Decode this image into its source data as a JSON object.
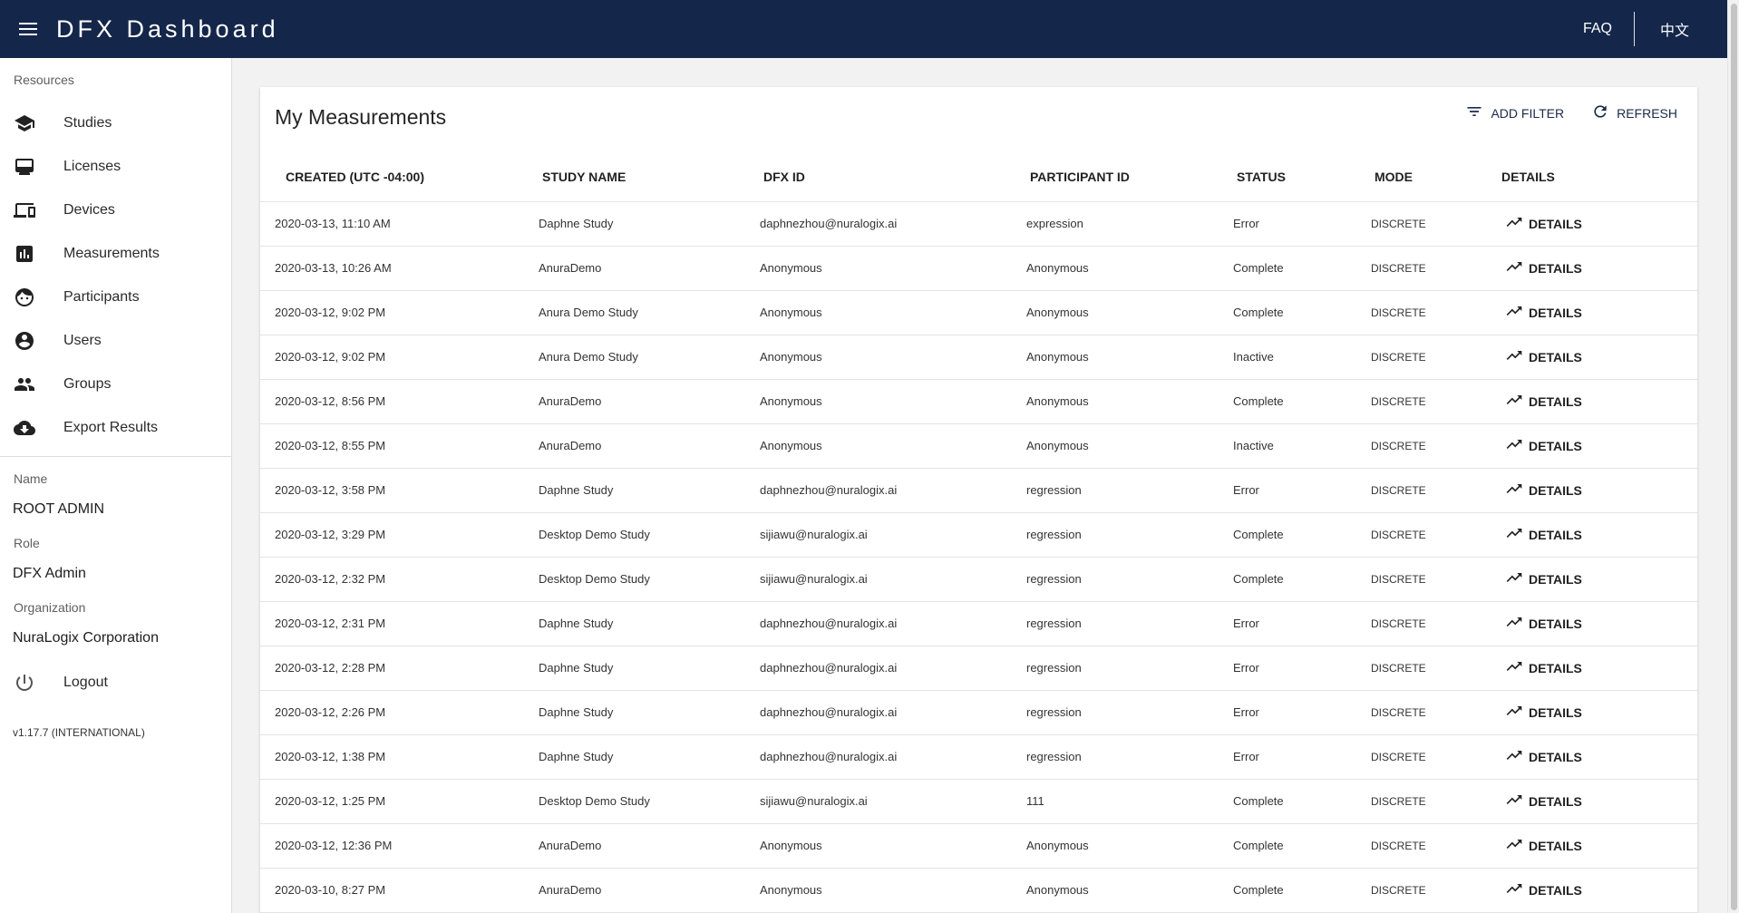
{
  "app": {
    "title": "DFX Dashboard",
    "faq_label": "FAQ",
    "lang_label": "中文"
  },
  "sidebar": {
    "resources_label": "Resources",
    "items": [
      {
        "label": "Studies",
        "icon": "school-icon"
      },
      {
        "label": "Licenses",
        "icon": "license-icon"
      },
      {
        "label": "Devices",
        "icon": "devices-icon"
      },
      {
        "label": "Measurements",
        "icon": "bar-chart-icon"
      },
      {
        "label": "Participants",
        "icon": "face-icon"
      },
      {
        "label": "Users",
        "icon": "account-circle-icon"
      },
      {
        "label": "Groups",
        "icon": "people-icon"
      },
      {
        "label": "Export Results",
        "icon": "cloud-download-icon"
      }
    ],
    "name_label": "Name",
    "name_value": "ROOT ADMIN",
    "role_label": "Role",
    "role_value": "DFX Admin",
    "org_label": "Organization",
    "org_value": "NuraLogix Corporation",
    "logout_label": "Logout",
    "version": "v1.17.7 (INTERNATIONAL)"
  },
  "main": {
    "title": "My Measurements",
    "add_filter_label": "ADD FILTER",
    "refresh_label": "REFRESH",
    "columns": [
      "CREATED (UTC -04:00)",
      "STUDY NAME",
      "DFX ID",
      "PARTICIPANT ID",
      "STATUS",
      "MODE",
      "DETAILS"
    ],
    "details_label": "DETAILS",
    "rows": [
      [
        "2020-03-13, 11:10 AM",
        "Daphne Study",
        "daphnezhou@nuralogix.ai",
        "expression",
        "Error",
        "DISCRETE"
      ],
      [
        "2020-03-13, 10:26 AM",
        "AnuraDemo",
        "Anonymous",
        "Anonymous",
        "Complete",
        "DISCRETE"
      ],
      [
        "2020-03-12, 9:02 PM",
        "Anura Demo Study",
        "Anonymous",
        "Anonymous",
        "Complete",
        "DISCRETE"
      ],
      [
        "2020-03-12, 9:02 PM",
        "Anura Demo Study",
        "Anonymous",
        "Anonymous",
        "Inactive",
        "DISCRETE"
      ],
      [
        "2020-03-12, 8:56 PM",
        "AnuraDemo",
        "Anonymous",
        "Anonymous",
        "Complete",
        "DISCRETE"
      ],
      [
        "2020-03-12, 8:55 PM",
        "AnuraDemo",
        "Anonymous",
        "Anonymous",
        "Inactive",
        "DISCRETE"
      ],
      [
        "2020-03-12, 3:58 PM",
        "Daphne Study",
        "daphnezhou@nuralogix.ai",
        "regression",
        "Error",
        "DISCRETE"
      ],
      [
        "2020-03-12, 3:29 PM",
        "Desktop Demo Study",
        "sijiawu@nuralogix.ai",
        "regression",
        "Complete",
        "DISCRETE"
      ],
      [
        "2020-03-12, 2:32 PM",
        "Desktop Demo Study",
        "sijiawu@nuralogix.ai",
        "regression",
        "Complete",
        "DISCRETE"
      ],
      [
        "2020-03-12, 2:31 PM",
        "Daphne Study",
        "daphnezhou@nuralogix.ai",
        "regression",
        "Error",
        "DISCRETE"
      ],
      [
        "2020-03-12, 2:28 PM",
        "Daphne Study",
        "daphnezhou@nuralogix.ai",
        "regression",
        "Error",
        "DISCRETE"
      ],
      [
        "2020-03-12, 2:26 PM",
        "Daphne Study",
        "daphnezhou@nuralogix.ai",
        "regression",
        "Error",
        "DISCRETE"
      ],
      [
        "2020-03-12, 1:38 PM",
        "Daphne Study",
        "daphnezhou@nuralogix.ai",
        "regression",
        "Error",
        "DISCRETE"
      ],
      [
        "2020-03-12, 1:25 PM",
        "Desktop Demo Study",
        "sijiawu@nuralogix.ai",
        "111",
        "Complete",
        "DISCRETE"
      ],
      [
        "2020-03-12, 12:36 PM",
        "AnuraDemo",
        "Anonymous",
        "Anonymous",
        "Complete",
        "DISCRETE"
      ],
      [
        "2020-03-10, 8:27 PM",
        "AnuraDemo",
        "Anonymous",
        "Anonymous",
        "Complete",
        "DISCRETE"
      ]
    ]
  },
  "colors": {
    "appbar": "#14264a",
    "accent": "#1a2a4a"
  }
}
